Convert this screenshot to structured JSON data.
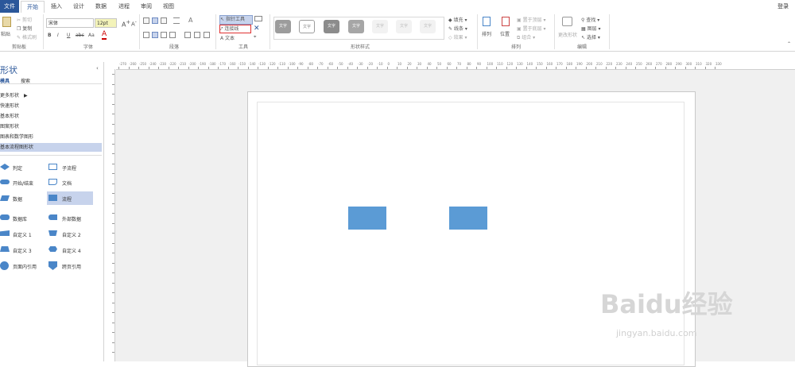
{
  "menu": {
    "file": "文件",
    "home": "开始",
    "insert": "插入",
    "design": "设计",
    "data": "数据",
    "process": "进程",
    "review": "审阅",
    "view": "视图",
    "login": "登录"
  },
  "ribbon": {
    "clipboard": {
      "label": "剪贴板",
      "paste": "粘贴",
      "cut": "剪切",
      "copy": "复制",
      "format_painter": "格式刷"
    },
    "font": {
      "label": "字体",
      "family": "宋体",
      "size": "12pt",
      "bold": "B",
      "italic": "I",
      "underline": "U",
      "strike": "abc",
      "case": "Aa",
      "color": "A"
    },
    "paragraph": {
      "label": "段落"
    },
    "tools": {
      "label": "工具",
      "pointer": "指针工具",
      "connector": "连接线",
      "text": "文本"
    },
    "shape_styles": {
      "label": "形状样式",
      "style_text": "文字",
      "fill": "填充",
      "line": "线条",
      "effect": "效果"
    },
    "arrange": {
      "label": "排列",
      "arrange": "排列",
      "position": "位置",
      "bring_front": "置于顶层",
      "send_back": "置于底层",
      "group": "组合"
    },
    "editing": {
      "label": "编辑",
      "change_shape": "更改形状",
      "find": "查找",
      "layers": "图层",
      "select": "选择"
    }
  },
  "panel": {
    "title": "形状",
    "tab_shapes": "模具",
    "tab_search": "搜索",
    "items": [
      "更多形状",
      "快速形状",
      "基本形状",
      "图案形状",
      "图表和数学图形",
      "基本流程图形状"
    ],
    "shapes": [
      [
        "判定",
        "子流程"
      ],
      [
        "开始/结束",
        "文档"
      ],
      [
        "数据",
        "流程"
      ],
      [
        "数据库",
        "外部数据"
      ],
      [
        "自定义 1",
        "自定义 2"
      ],
      [
        "自定义 3",
        "自定义 4"
      ],
      [
        "页面内引用",
        "跨页引用"
      ]
    ]
  },
  "ruler": {
    "h_ticks": [
      "-270",
      "-260",
      "-250",
      "-240",
      "-230",
      "-220",
      "-210",
      "-200",
      "-190",
      "-180",
      "-170",
      "-160",
      "-150",
      "-140",
      "-130",
      "-120",
      "-110",
      "-100",
      "-90",
      "-80",
      "-70",
      "-60",
      "-50",
      "-40",
      "-30",
      "-20",
      "-10",
      "0",
      "10",
      "20",
      "30",
      "40",
      "50",
      "60",
      "70",
      "80",
      "90",
      "100",
      "110",
      "120",
      "130",
      "140",
      "150",
      "160",
      "170",
      "180",
      "190",
      "200",
      "210",
      "220",
      "230",
      "240",
      "250",
      "260",
      "270",
      "280",
      "290",
      "300",
      "310",
      "320",
      "330"
    ]
  },
  "watermark": {
    "brand": "Baidu经验",
    "url": "jingyan.baidu.com"
  },
  "colors": {
    "accent": "#2b579a",
    "shape": "#5b9bd5",
    "selected": "#c7d3ec"
  }
}
